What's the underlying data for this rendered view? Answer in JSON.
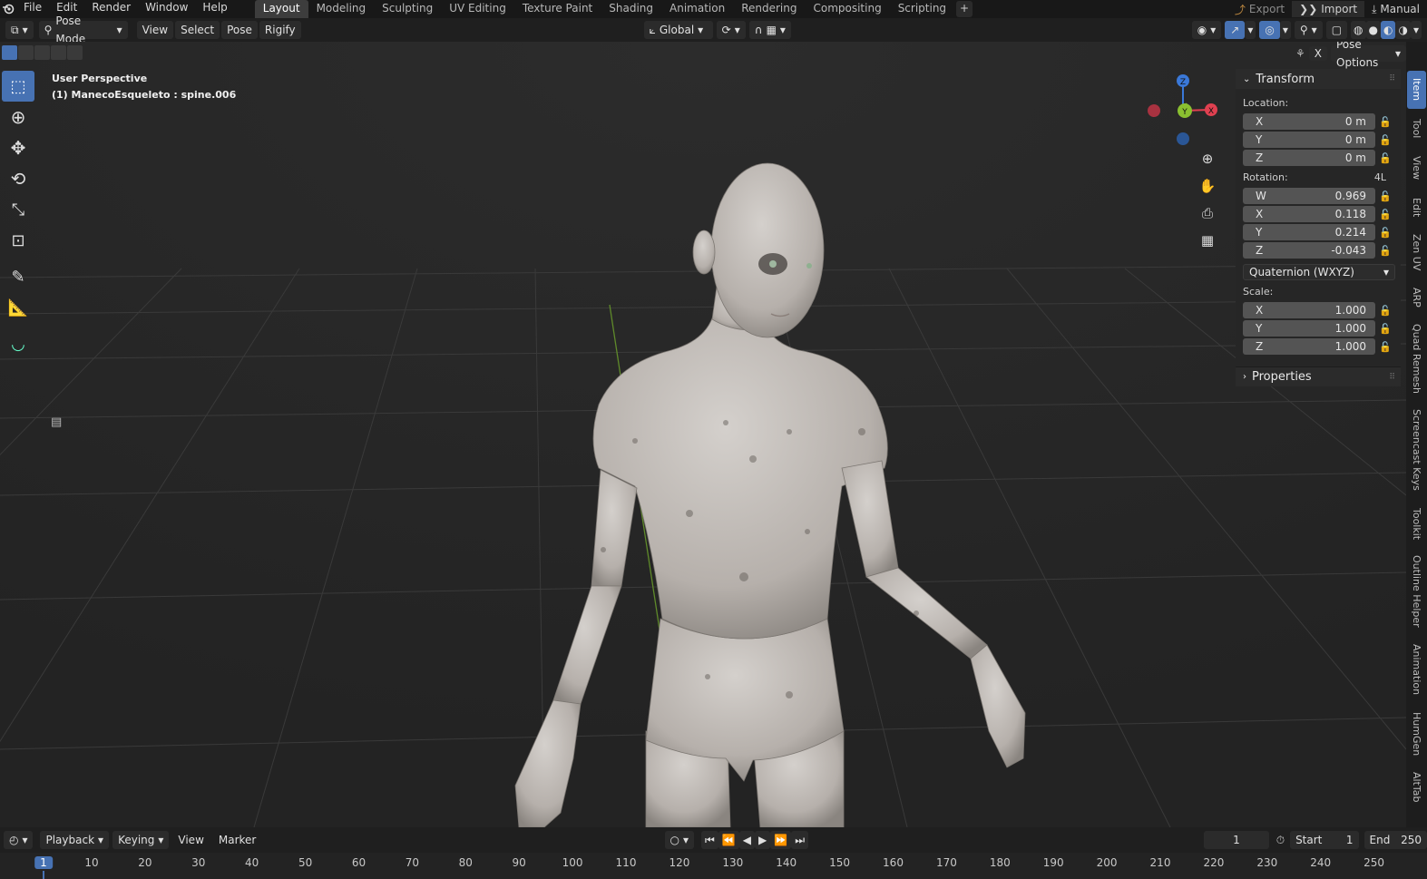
{
  "menu": [
    "File",
    "Edit",
    "Render",
    "Window",
    "Help"
  ],
  "workspaces": [
    "Layout",
    "Modeling",
    "Sculpting",
    "UV Editing",
    "Texture Paint",
    "Shading",
    "Animation",
    "Rendering",
    "Compositing",
    "Scripting"
  ],
  "topright": {
    "export": "Export",
    "import": "Import",
    "manual": "Manual"
  },
  "header": {
    "mode": "Pose Mode",
    "view": "View",
    "select": "Select",
    "pose": "Pose",
    "rigify": "Rigify",
    "orientation": "Global",
    "pose_options": "Pose Options",
    "x_label": "X"
  },
  "viewport": {
    "title": "User Perspective",
    "subtitle": "(1) ManecoEsqueleto : spine.006"
  },
  "gizmo": {
    "z": "Z",
    "x": "X",
    "y": "Y"
  },
  "npanel": {
    "transform_title": "Transform",
    "location_label": "Location:",
    "location": [
      {
        "axis": "X",
        "value": "0 m"
      },
      {
        "axis": "Y",
        "value": "0 m"
      },
      {
        "axis": "Z",
        "value": "0 m"
      }
    ],
    "rotation_label": "Rotation:",
    "rotation_mode_short": "4L",
    "rotation": [
      {
        "axis": "W",
        "value": "0.969"
      },
      {
        "axis": "X",
        "value": "0.118"
      },
      {
        "axis": "Y",
        "value": "0.214"
      },
      {
        "axis": "Z",
        "value": "-0.043"
      }
    ],
    "rotation_mode": "Quaternion (WXYZ)",
    "scale_label": "Scale:",
    "scale": [
      {
        "axis": "X",
        "value": "1.000"
      },
      {
        "axis": "Y",
        "value": "1.000"
      },
      {
        "axis": "Z",
        "value": "1.000"
      }
    ],
    "properties_title": "Properties"
  },
  "side_tabs": [
    "Item",
    "Tool",
    "View",
    "Edit",
    "Zen UV",
    "ARP",
    "Quad Remesh",
    "Screencast Keys",
    "Toolkit",
    "Outline Helper",
    "Animation",
    "HumGen",
    "AltTab"
  ],
  "timeline": {
    "playback": "Playback",
    "keying": "Keying",
    "view": "View",
    "marker": "Marker",
    "current_frame": "1",
    "start_label": "Start",
    "start": "1",
    "end_label": "End",
    "end": "250",
    "ruler": [
      "1",
      "10",
      "20",
      "30",
      "40",
      "50",
      "60",
      "70",
      "80",
      "90",
      "100",
      "110",
      "120",
      "130",
      "140",
      "150",
      "160",
      "170",
      "180",
      "190",
      "200",
      "210",
      "220",
      "230",
      "240",
      "250"
    ]
  },
  "colors": {
    "accent": "#4772b3",
    "axis_x": "#e04050",
    "axis_y": "#8ac030",
    "axis_z": "#3a78d8"
  }
}
